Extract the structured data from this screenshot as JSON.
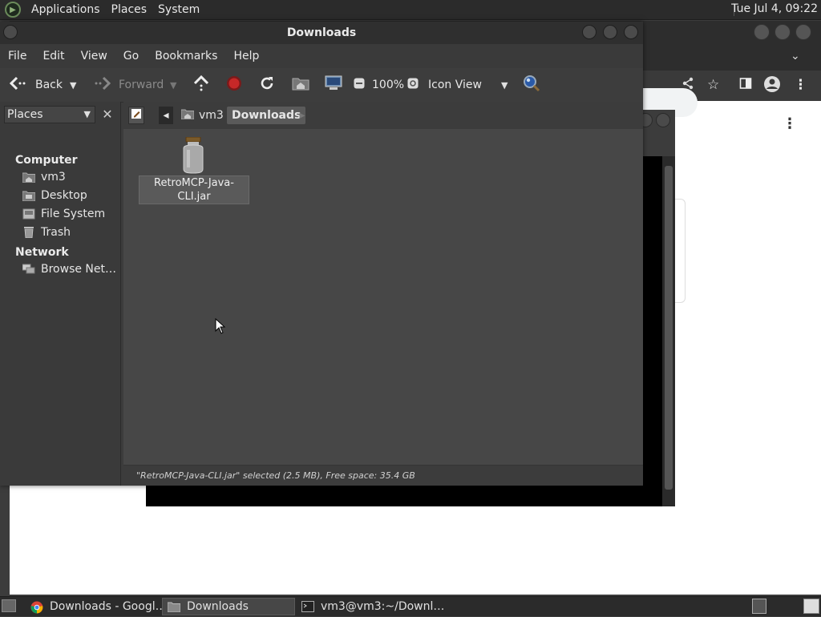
{
  "top_panel": {
    "menus": [
      "Applications",
      "Places",
      "System"
    ],
    "clock": "Tue Jul  4, 09:22"
  },
  "nautilus": {
    "title": "Downloads",
    "menubar": [
      "File",
      "Edit",
      "View",
      "Go",
      "Bookmarks",
      "Help"
    ],
    "toolbar": {
      "back": "Back",
      "forward": "Forward",
      "zoom": "100%",
      "view_mode": "Icon View"
    },
    "sidebar": {
      "selector": "Places",
      "sections": [
        {
          "heading": "Computer",
          "items": [
            "vm3",
            "Desktop",
            "File System",
            "Trash"
          ]
        },
        {
          "heading": "Network",
          "items": [
            "Browse Net…"
          ]
        }
      ]
    },
    "pathbar": {
      "crumbs": [
        "vm3",
        "Downloads"
      ]
    },
    "files": [
      {
        "name_line1": "RetroMCP-Java-",
        "name_line2": "CLI.jar",
        "icon": "jar-icon",
        "selected": true
      }
    ],
    "status": "\"RetroMCP-Java-CLI.jar\" selected (2.5 MB), Free space: 35.4 GB"
  },
  "taskbar": {
    "tasks": [
      "Downloads - Googl…",
      "Downloads",
      "vm3@vm3:~/Downl…"
    ]
  }
}
